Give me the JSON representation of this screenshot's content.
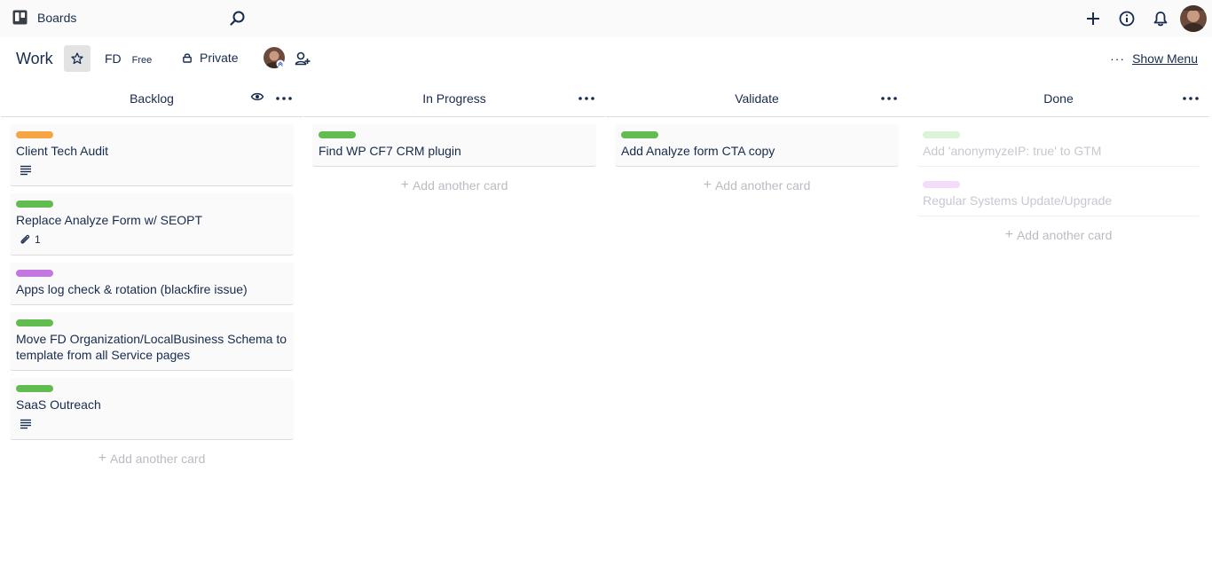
{
  "topbar": {
    "boards_label": "Boards",
    "icons": [
      "boards-icon",
      "search-icon",
      "plus-icon",
      "info-icon",
      "bell-icon",
      "avatar"
    ]
  },
  "board": {
    "title": "Work",
    "team_name": "FD",
    "team_plan": "Free",
    "privacy": "Private",
    "show_menu": "Show Menu",
    "menu_dots": "···"
  },
  "colors": {
    "orange": "#f6a544",
    "green": "#61bd4f",
    "purple": "#c377e0",
    "green_faded": "#dbf3d6",
    "purple_faded": "#f3dcf7"
  },
  "lists": [
    {
      "title": "Backlog",
      "watched": true,
      "cards": [
        {
          "label_color": "#f6a544",
          "title": "Client Tech Audit",
          "description_icon": true
        },
        {
          "label_color": "#61bd4f",
          "title": "Replace Analyze Form w/ SEOPT",
          "attachments": "1"
        },
        {
          "label_color": "#c377e0",
          "title": "Apps log check & rotation (blackfire issue)"
        },
        {
          "label_color": "#61bd4f",
          "title": "Move FD Organization/LocalBusiness Schema to template from all Service pages"
        },
        {
          "label_color": "#61bd4f",
          "title": "SaaS Outreach",
          "description_icon": true
        }
      ],
      "add_label": "Add another card"
    },
    {
      "title": "In Progress",
      "cards": [
        {
          "label_color": "#61bd4f",
          "title": "Find WP CF7 CRM plugin"
        }
      ],
      "add_label": "Add another card"
    },
    {
      "title": "Validate",
      "cards": [
        {
          "label_color": "#61bd4f",
          "title": "Add Analyze form CTA copy"
        }
      ],
      "add_label": "Add another card"
    },
    {
      "title": "Done",
      "cards": [
        {
          "label_color": "#dbf3d6",
          "title": "Add 'anonymyzeIP: true' to GTM",
          "faded": true
        },
        {
          "label_color": "#f3dcf7",
          "title": "Regular Systems Update/Upgrade",
          "faded": true
        }
      ],
      "add_label": "Add another card"
    }
  ]
}
